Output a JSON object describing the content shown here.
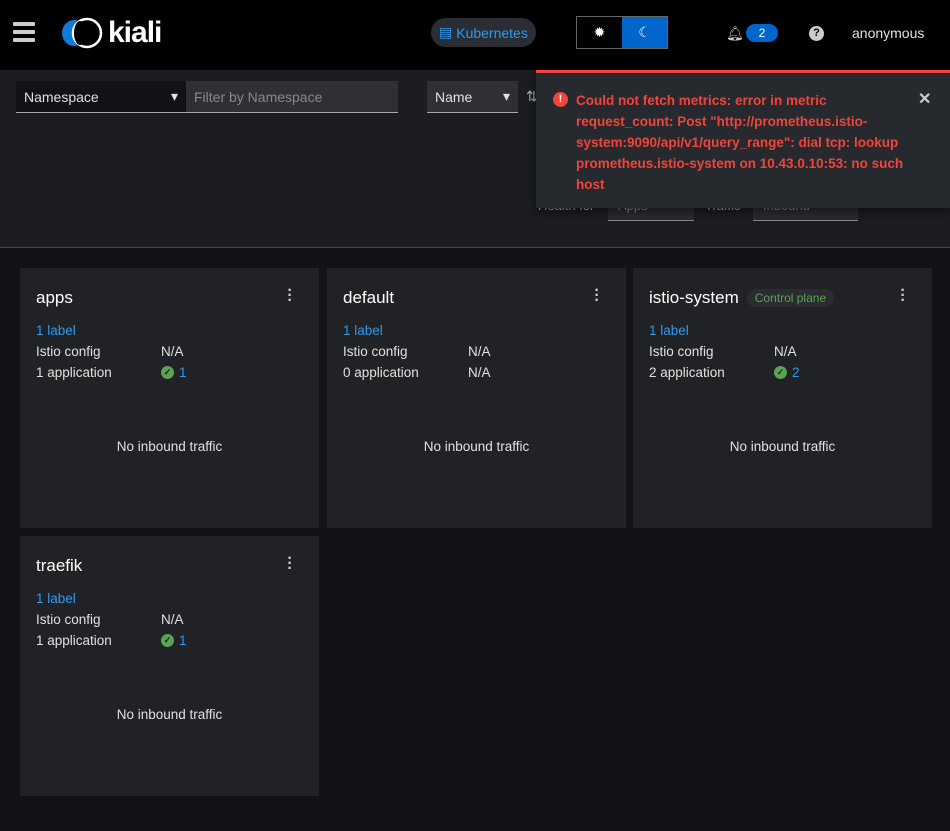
{
  "header": {
    "logo_text": "kiali",
    "cluster_label": "Kubernetes",
    "notifications_count": "2",
    "help": "?",
    "user": "anonymous"
  },
  "toolbar": {
    "namespace_select": "Namespace",
    "filter_placeholder": "Filter by Namespace",
    "sort_select": "Name",
    "health_label": "Health for",
    "health_value": "Apps",
    "traffic_label": "Traffic",
    "traffic_value": "Inbound"
  },
  "toast": {
    "message": "Could not fetch metrics: error in metric request_count: Post \"http://prometheus.istio-system:9090/api/v1/query_range\": dial tcp: lookup prometheus.istio-system on 10.43.0.10:53: no such host",
    "color": "#f0453b"
  },
  "labels": {
    "istio_config": "Istio config"
  },
  "cards": [
    {
      "name": "apps",
      "badge": "",
      "labels": "1 label",
      "istio_config": "N/A",
      "apps_label": "1 application",
      "apps_value": "1",
      "apps_ok": true,
      "traffic": "No inbound traffic"
    },
    {
      "name": "default",
      "badge": "",
      "labels": "1 label",
      "istio_config": "N/A",
      "apps_label": "0 application",
      "apps_value": "N/A",
      "apps_ok": false,
      "traffic": "No inbound traffic"
    },
    {
      "name": "istio-system",
      "badge": "Control plane",
      "labels": "1 label",
      "istio_config": "N/A",
      "apps_label": "2 application",
      "apps_value": "2",
      "apps_ok": true,
      "traffic": "No inbound traffic"
    },
    {
      "name": "traefik",
      "badge": "",
      "labels": "1 label",
      "istio_config": "N/A",
      "apps_label": "1 application",
      "apps_value": "1",
      "apps_ok": true,
      "traffic": "No inbound traffic"
    }
  ]
}
